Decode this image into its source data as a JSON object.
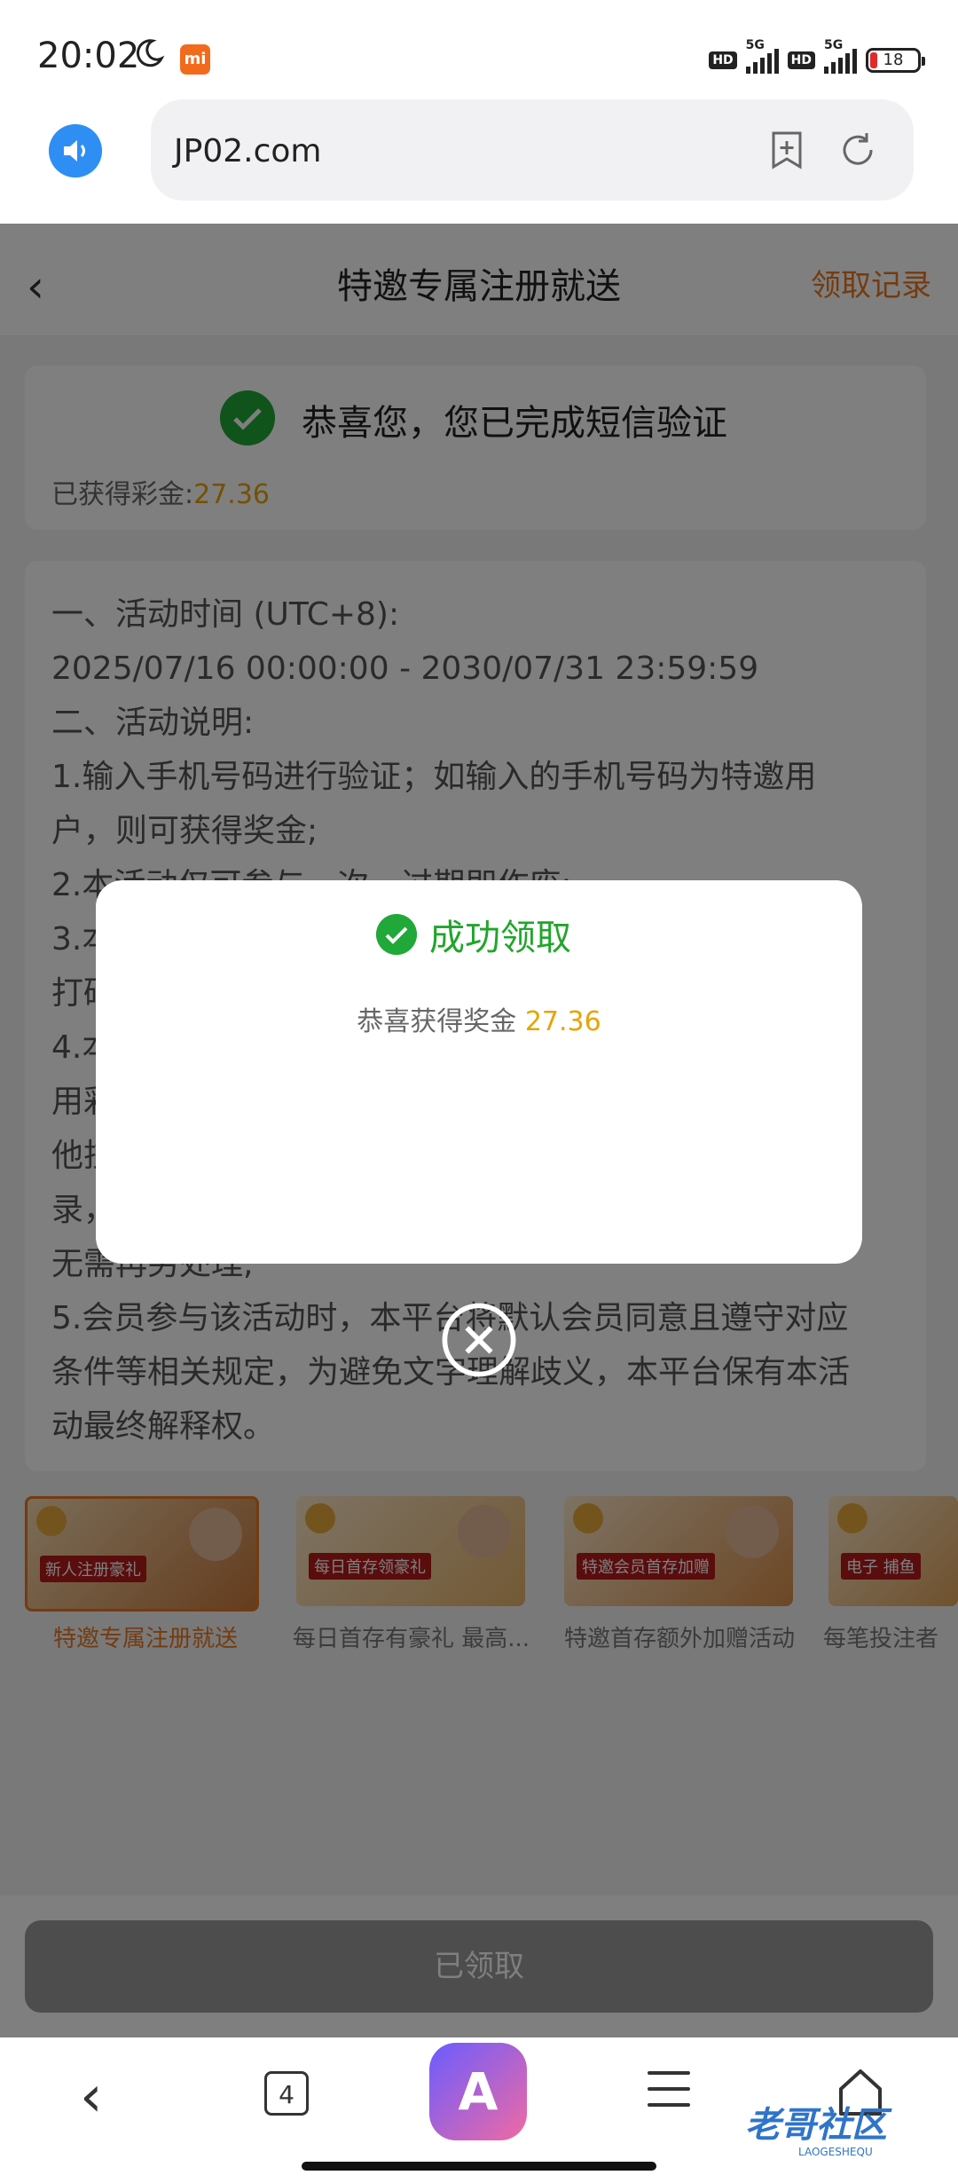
{
  "status_bar": {
    "time": "20:02",
    "network_1": "5G",
    "network_2": "5G",
    "hd": "HD",
    "battery": "18"
  },
  "browser": {
    "url": "JP02.com"
  },
  "header": {
    "title": "特邀专属注册就送",
    "right_link": "领取记录"
  },
  "verify_card": {
    "message": "恭喜您，您已完成短信验证",
    "earned_label": "已获得彩金:",
    "earned_amount": "27.36"
  },
  "rules": [
    "一、活动时间 (UTC+8):",
    "2025/07/16 00:00:00 - 2030/07/31 23:59:59",
    "二、活动说明:",
    "1.输入手机号码进行验证；如输入的手机号码为特邀用",
    "户，则可获得奖金;",
    "2.本活动仅可参与一次，过期即作废;",
    "3.本",
    "打码",
    "4.本",
    "用彩",
    "他技",
    "录，",
    "无需再另处理;",
    "5.会员参与该活动时，本平台将默认会员同意且遵守对应",
    "条件等相关规定，为避免文字理解歧义，本平台保有本活",
    "动最终解释权。"
  ],
  "banners": [
    {
      "label": "特邀专属注册就送",
      "tag": "新人注册豪礼"
    },
    {
      "label": "每日首存有豪礼 最高...",
      "tag": "每日首存领豪礼"
    },
    {
      "label": "特邀首存额外加赠活动",
      "tag": "特邀会员首存加赠"
    },
    {
      "label": "每笔投注者",
      "tag": "电子 捕鱼"
    }
  ],
  "footer": {
    "button": "已领取"
  },
  "modal": {
    "title": "成功领取",
    "message_prefix": "恭喜获得奖金",
    "amount": "27.36"
  },
  "nav": {
    "tab_count": "4",
    "ai_label": "A"
  },
  "watermark": {
    "text": "老哥社区",
    "sub": "LAOGESHEQU"
  },
  "colors": {
    "accent_orange": "#e8771f",
    "amount_gold": "#e8a300",
    "success_green": "#22a52c",
    "browser_blue": "#2f8ef4"
  }
}
